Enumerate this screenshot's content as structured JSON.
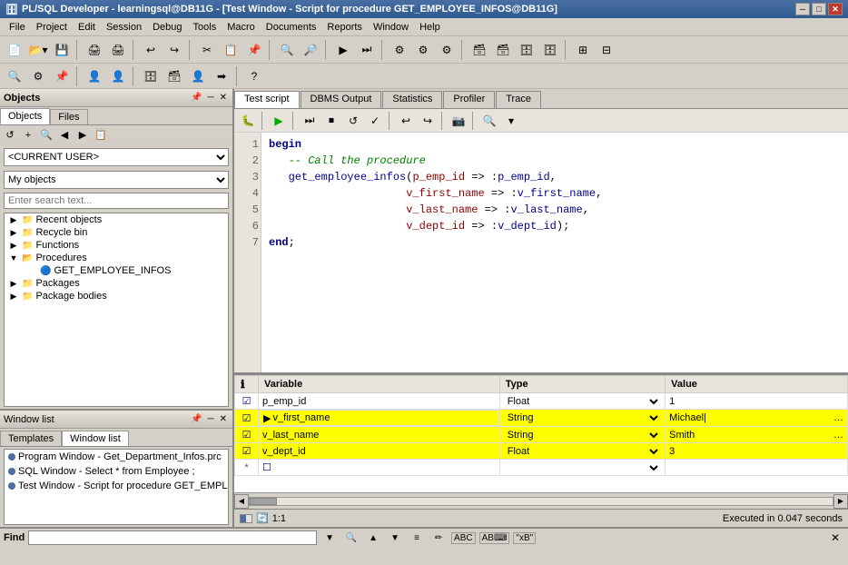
{
  "window": {
    "title": "PL/SQL Developer - learningsql@DB11G - [Test Window - Script for procedure GET_EMPLOYEE_INFOS@DB11G]",
    "app_icon": "🗄"
  },
  "titlebar": {
    "close": "✕",
    "maximize": "□",
    "minimize": "─",
    "inner_close": "✕",
    "inner_maximize": "□",
    "inner_minimize": "─"
  },
  "menu": {
    "items": [
      "File",
      "Project",
      "Edit",
      "Session",
      "Debug",
      "Tools",
      "Macro",
      "Documents",
      "Reports",
      "Window",
      "Help"
    ]
  },
  "objects_panel": {
    "title": "Objects",
    "tabs": [
      "Objects",
      "Files"
    ],
    "toolbar_btns": [
      "↺",
      "+",
      "🔍",
      "←",
      "→",
      "📋"
    ],
    "current_user_label": "<CURRENT USER>",
    "my_objects_label": "My objects",
    "search_placeholder": "Enter search text...",
    "tree": [
      {
        "label": "Recent objects",
        "level": 0,
        "icon": "📁",
        "expand": "▶"
      },
      {
        "label": "Recycle bin",
        "level": 0,
        "icon": "📁",
        "expand": "▶"
      },
      {
        "label": "Functions",
        "level": 0,
        "icon": "📁",
        "expand": "▶"
      },
      {
        "label": "Procedures",
        "level": 0,
        "icon": "📂",
        "expand": "▼"
      },
      {
        "label": "GET_EMPLOYEE_INFOS",
        "level": 1,
        "icon": "🔧",
        "expand": ""
      },
      {
        "label": "Packages",
        "level": 0,
        "icon": "📁",
        "expand": "▶"
      },
      {
        "label": "Package bodies",
        "level": 0,
        "icon": "📁",
        "expand": "▶"
      }
    ]
  },
  "window_list": {
    "title": "Window list",
    "tabs": [
      "Templates",
      "Window list"
    ],
    "items": [
      {
        "label": "Program Window - Get_Department_Infos.prc",
        "color": "blue"
      },
      {
        "label": "SQL Window - Select * from Employee ;",
        "color": "blue"
      },
      {
        "label": "Test Window - Script for procedure GET_EMPLI",
        "color": "blue"
      }
    ]
  },
  "editor": {
    "tabs": [
      "Test script",
      "DBMS Output",
      "Statistics",
      "Profiler",
      "Trace"
    ],
    "active_tab": "Test script",
    "code": {
      "lines": [
        {
          "num": "1",
          "content": "begin"
        },
        {
          "num": "2",
          "content": "   -- Call the procedure"
        },
        {
          "num": "3",
          "content": "   get_employee_infos(p_emp_id => :p_emp_id,"
        },
        {
          "num": "4",
          "content": "                     v_first_name => :v_first_name,"
        },
        {
          "num": "5",
          "content": "                     v_last_name => :v_last_name,"
        },
        {
          "num": "6",
          "content": "                     v_dept_id => :v_dept_id);"
        },
        {
          "num": "7",
          "content": "end;"
        }
      ]
    },
    "variables": {
      "headers": [
        "",
        "Variable",
        "Type",
        "Value"
      ],
      "rows": [
        {
          "check": true,
          "name": "p_emp_id",
          "type": "Float",
          "value": "1",
          "highlight": false,
          "arrow": false
        },
        {
          "check": true,
          "name": "v_first_name",
          "type": "String",
          "value": "Michael",
          "highlight": true,
          "arrow": true
        },
        {
          "check": true,
          "name": "v_last_name",
          "type": "String",
          "value": "Smith",
          "highlight": true,
          "arrow": false
        },
        {
          "check": true,
          "name": "v_dept_id",
          "type": "Float",
          "value": "3",
          "highlight": true,
          "arrow": false
        },
        {
          "check": false,
          "name": "",
          "type": "",
          "value": "",
          "highlight": false,
          "arrow": false
        }
      ]
    }
  },
  "status": {
    "position": "1:1",
    "message": "Executed in 0.047 seconds"
  },
  "find_bar": {
    "label": "Find",
    "placeholder": "",
    "btns": [
      "▼",
      "🔍",
      "▲",
      "▼",
      "≡",
      "✏",
      "ABC",
      "AB⌨",
      "\"xB\""
    ]
  }
}
